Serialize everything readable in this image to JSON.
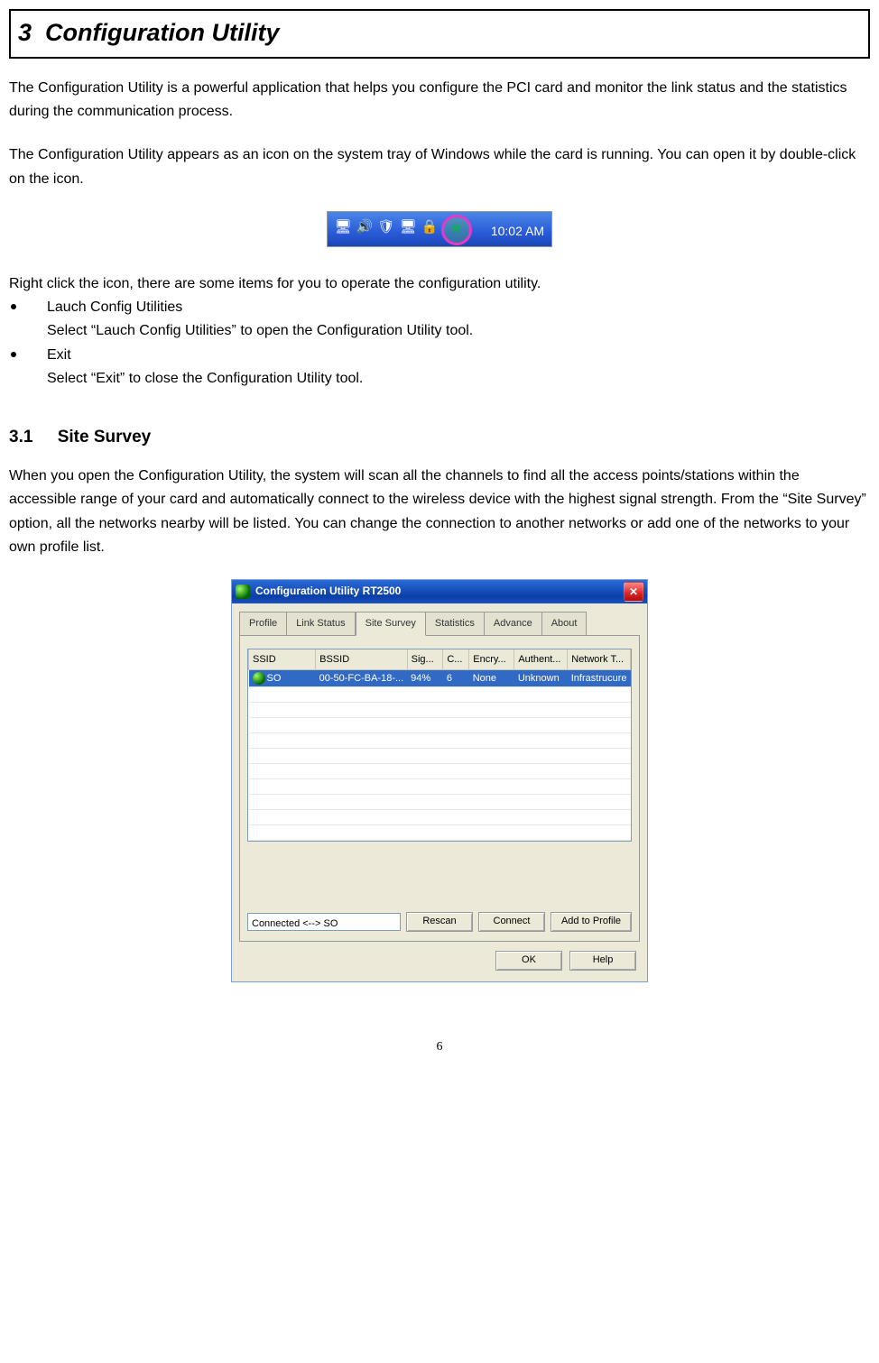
{
  "chapter": {
    "number": "3",
    "title": "Configuration Utility"
  },
  "para1": "The Configuration Utility is a powerful application that helps you configure the PCI card and monitor the link status and the statistics during the communication process.",
  "para2": "The Configuration Utility appears as an icon on the system tray of Windows while the card is running. You can open it by double-click on the icon.",
  "tray": {
    "clock": "10:02 AM",
    "circled_icon_label": "R"
  },
  "para3": "Right click the icon, there are some items for you to operate the configuration utility.",
  "bullets": [
    {
      "title": "Lauch Config Utilities",
      "desc": "Select “Lauch Config Utilities” to open the Configuration Utility tool."
    },
    {
      "title": "Exit",
      "desc": "Select “Exit” to close the Configuration Utility tool."
    }
  ],
  "section": {
    "number": "3.1",
    "title": "Site Survey"
  },
  "para4": "When you open the Configuration Utility, the system will scan all the channels to find all the access points/stations within the accessible range of your card and automatically connect to the wireless device with the highest signal strength. From the “Site Survey” option, all the networks nearby will be listed. You can change the connection to another networks or add one of the networks to your own profile list.",
  "window": {
    "title": "Configuration Utility RT2500",
    "tabs": [
      "Profile",
      "Link Status",
      "Site Survey",
      "Statistics",
      "Advance",
      "About"
    ],
    "active_tab_index": 2,
    "columns": [
      "SSID",
      "BSSID",
      "Sig...",
      "C...",
      "Encry...",
      "Authent...",
      "Network T..."
    ],
    "rows": [
      {
        "ssid": "SO",
        "bssid": "00-50-FC-BA-18-...",
        "signal": "94%",
        "channel": "6",
        "encryption": "None",
        "auth": "Unknown",
        "nettype": "Infrastrucure"
      }
    ],
    "empty_rows": 10,
    "status": "Connected <--> SO",
    "buttons": {
      "rescan": "Rescan",
      "connect": "Connect",
      "add": "Add to Profile",
      "ok": "OK",
      "help": "Help"
    }
  },
  "page_number": "6"
}
